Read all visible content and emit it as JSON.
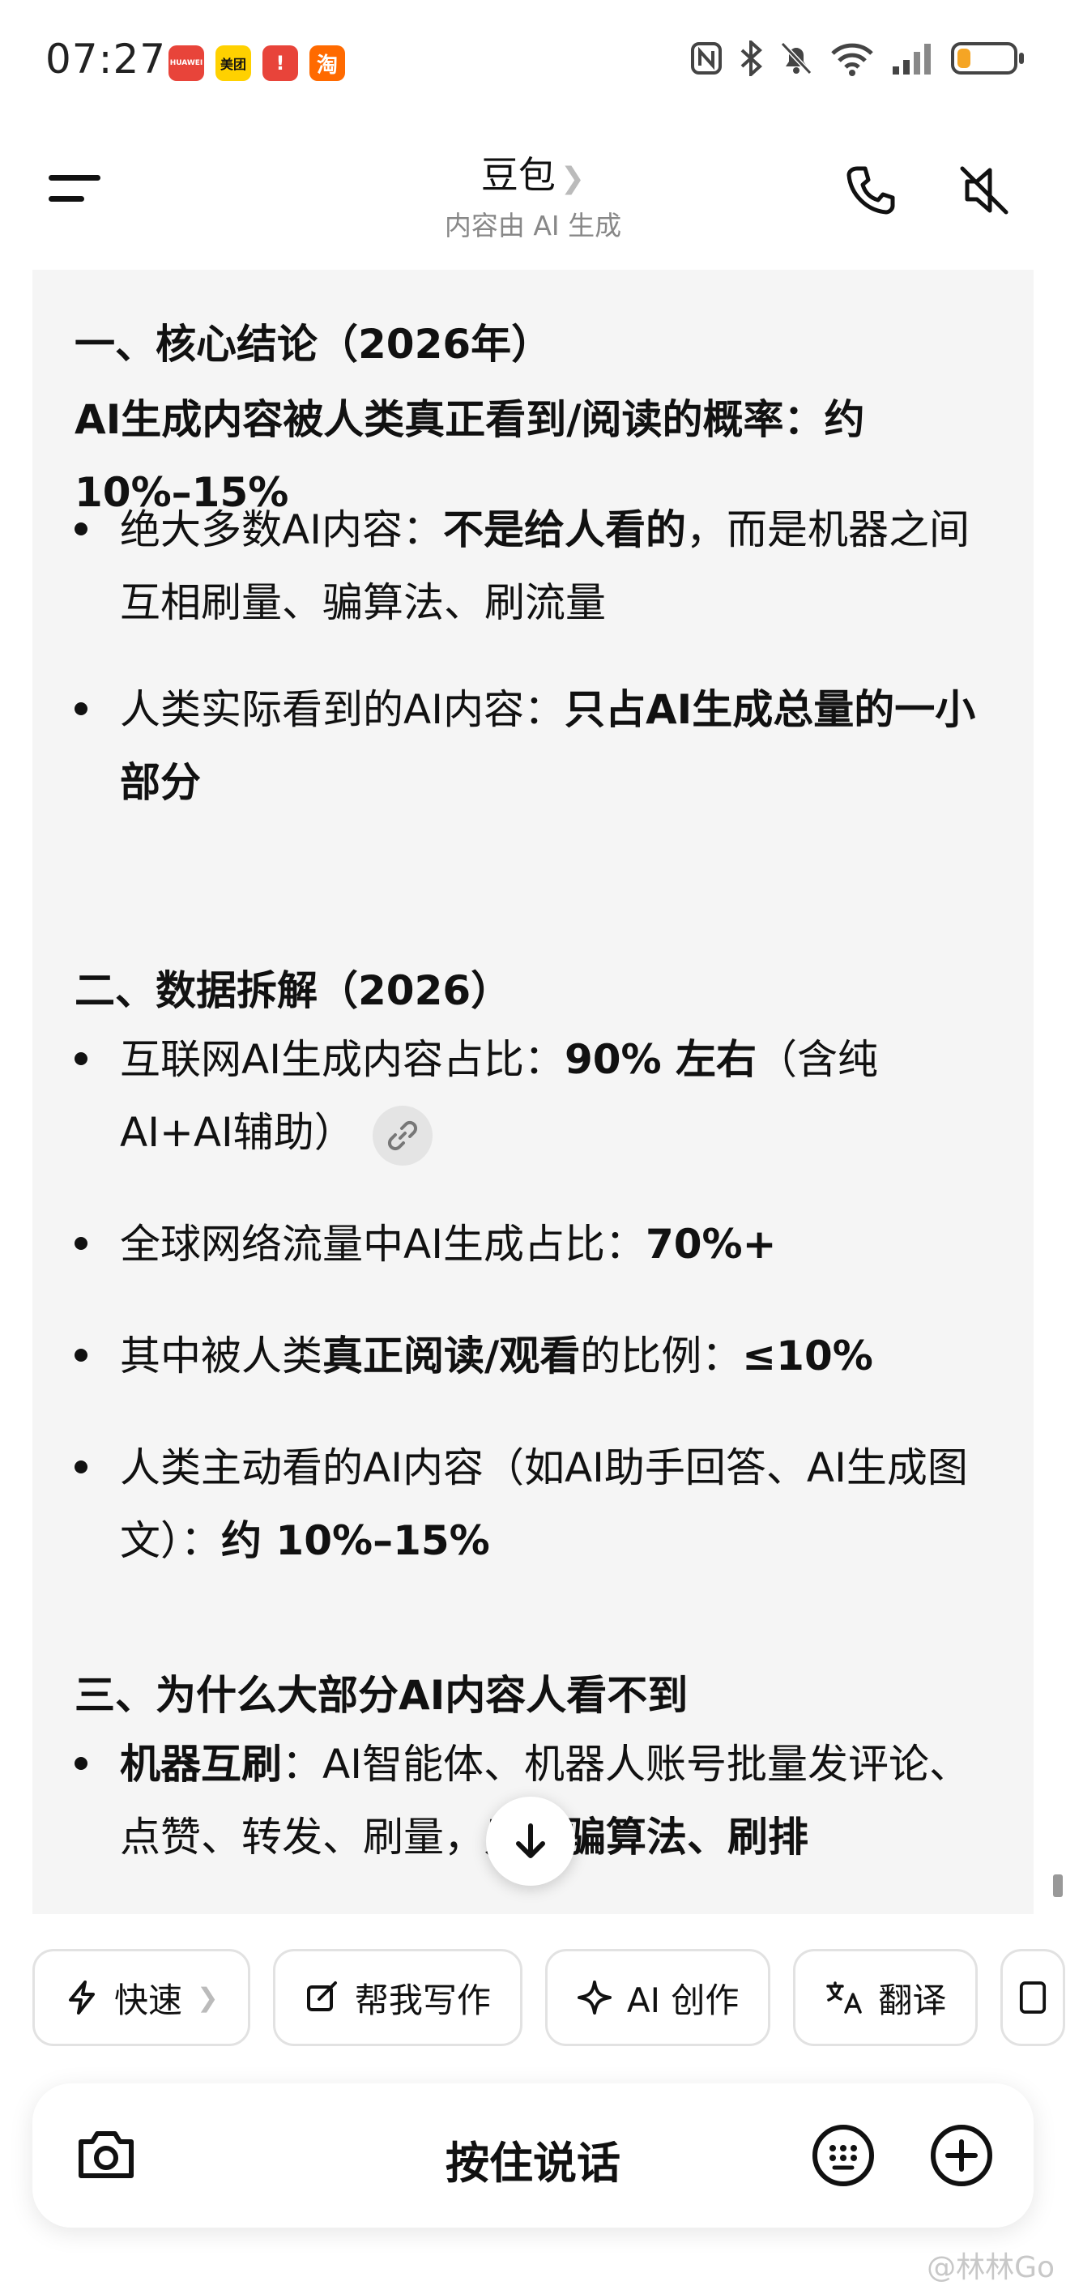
{
  "status_bar": {
    "time": "07:27",
    "apps": [
      {
        "name": "HUAWEI",
        "color": "#e8443a"
      },
      {
        "name": "美团",
        "color": "#ffd100"
      },
      {
        "name": "!",
        "color": "#e8443a"
      },
      {
        "name": "淘",
        "color": "#ff6a00"
      }
    ],
    "battery_level": 0.22,
    "battery_color": "#f5a524"
  },
  "header": {
    "title": "豆包",
    "subtitle": "内容由 AI 生成",
    "menu_icon": "hamburger-icon",
    "phone_icon": "phone-icon",
    "mute_icon": "speaker-mute-icon"
  },
  "content": {
    "section1_title": "一、核心结论（2026年）",
    "lead": "AI生成内容被人类真正看到/阅读的概率：约 10%–15%",
    "b1_pre": "绝大多数AI内容：",
    "b1_bold": "不是给人看的",
    "b1_post": "，而是机器之间互相刷量、骗算法、刷流量",
    "b2_pre": "人类实际看到的AI内容：",
    "b2_bold": "只占AI生成总量的一小部分",
    "section2_title": "二、数据拆解（2026）",
    "b3_pre": "互联网AI生成内容占比：",
    "b3_bold": "90% 左右",
    "b3_post": "（含纯AI+AI辅助）",
    "b4_pre": "全球网络流量中AI生成占比：",
    "b4_bold": "70%+",
    "b5_pre": "其中被人类",
    "b5_bold": "真正阅读/观看",
    "b5_mid": "的比例：",
    "b5_bold2": "≤10%",
    "b6_pre": "人类主动看的AI内容（如AI助手回答、AI生成图文）：",
    "b6_bold": "约 10%–15%",
    "section3_title": "三、为什么大部分AI内容人看不到",
    "b7_bold": "机器互刷",
    "b7_mid": "：AI智能体、机器人账号批量发评论、点赞、转发、刷量，",
    "b7_bold2": "只为骗算法、刷排"
  },
  "quick_actions": {
    "fast": "快速",
    "write": "帮我写作",
    "create": "AI 创作",
    "translate": "翻译"
  },
  "input_bar": {
    "hold_to_talk": "按住说话"
  },
  "watermark": "@林林Go"
}
